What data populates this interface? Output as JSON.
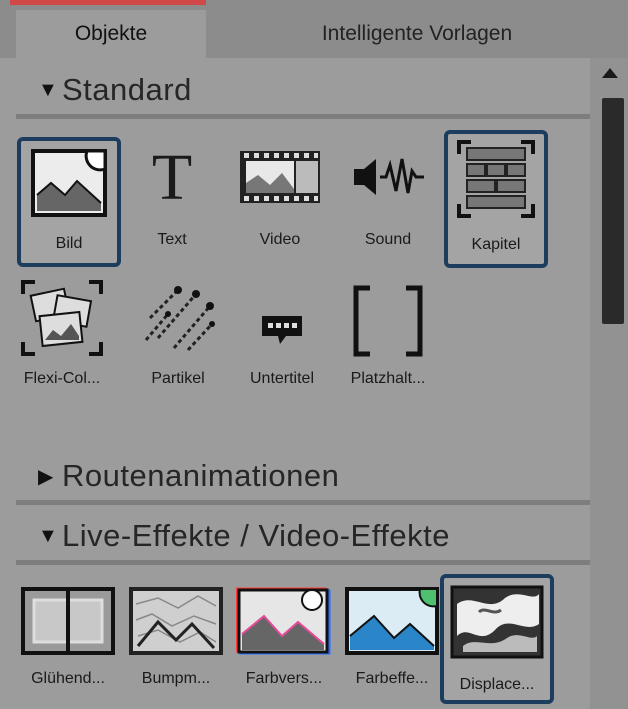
{
  "tabs": {
    "objects": "Objekte",
    "templates": "Intelligente Vorlagen"
  },
  "sections": {
    "standard": "Standard",
    "routes": "Routenanimationen",
    "live": "Live-Effekte / Video-Effekte"
  },
  "standard_items": [
    "Bild",
    "Text",
    "Video",
    "Sound",
    "Kapitel",
    "Flexi-Col...",
    "Partikel",
    "Untertitel",
    "Platzhalt..."
  ],
  "live_items": [
    "Glühend...",
    "Bumpm...",
    "Farbvers...",
    "Farbeffe...",
    "Displace..."
  ],
  "colors": {
    "selection": "#1c3d5e",
    "accent_red": "#d04848"
  }
}
